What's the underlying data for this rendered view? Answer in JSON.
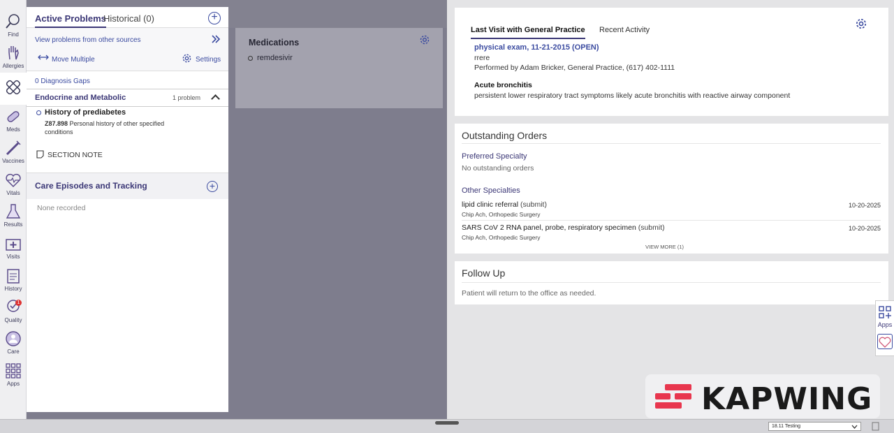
{
  "rail": [
    {
      "label": "Find",
      "icon": "search-icon"
    },
    {
      "label": "Allergies",
      "icon": "hand-icon"
    },
    {
      "label": "",
      "icon": "bandage-icon"
    },
    {
      "label": "Meds",
      "icon": "pill-icon"
    },
    {
      "label": "Vaccines",
      "icon": "syringe-icon"
    },
    {
      "label": "Vitals",
      "icon": "heart-icon"
    },
    {
      "label": "Results",
      "icon": "flask-icon"
    },
    {
      "label": "Visits",
      "icon": "medkit-icon"
    },
    {
      "label": "History",
      "icon": "clipboard-icon"
    },
    {
      "label": "Quality",
      "icon": "quality-check-icon",
      "badge": "1"
    },
    {
      "label": "Care",
      "icon": "care-team-icon"
    },
    {
      "label": "Apps",
      "icon": "grid-icon"
    }
  ],
  "problems": {
    "tab_active": "Active Problems",
    "tab_historical": "Historical (0)",
    "other_sources": "View problems from other sources",
    "move_multiple": "Move Multiple",
    "settings": "Settings",
    "diagnosis_gaps": "0 Diagnosis Gaps",
    "group": {
      "title": "Endocrine and Metabolic",
      "count": "1 problem"
    },
    "item": {
      "name": "History of prediabetes",
      "code": "Z87.898",
      "desc": "Personal history of other specified conditions"
    },
    "section_note": "SECTION NOTE",
    "care_title": "Care Episodes and Tracking",
    "care_empty": "None recorded"
  },
  "medications": {
    "title": "Medications",
    "items": [
      "remdesivir"
    ]
  },
  "visit": {
    "tab_active": "Last Visit with General Practice",
    "tab_recent": "Recent Activity",
    "exam": "physical exam, 11-21-2015 (OPEN)",
    "note": "rrere",
    "performed_by": "Performed by Adam Bricker, General Practice, (617) 402-1111",
    "diagnosis": "Acute bronchitis",
    "diagnosis_note": "persistent lower respiratory tract symptoms likely acute bronchitis with reactive airway component"
  },
  "orders": {
    "title": "Outstanding Orders",
    "preferred_title": "Preferred Specialty",
    "preferred_empty": "No outstanding orders",
    "other_title": "Other Specialties",
    "rows": [
      {
        "name": "lipid clinic referral",
        "status": "(submit)",
        "by": "Chip Ach, Orthopedic Surgery",
        "date": "10-20-2025"
      },
      {
        "name": "SARS CoV 2 RNA panel, probe, respiratory specimen",
        "status": "(submit)",
        "by": "Chip Ach, Orthopedic Surgery",
        "date": "10-20-2025"
      }
    ],
    "view_more": "VIEW MORE (1)"
  },
  "followup": {
    "title": "Follow Up",
    "text": "Patient will return to the office as needed."
  },
  "side_apps": {
    "label": "Apps"
  },
  "watermark": "KAPWING",
  "version": "18.11 Testing"
}
